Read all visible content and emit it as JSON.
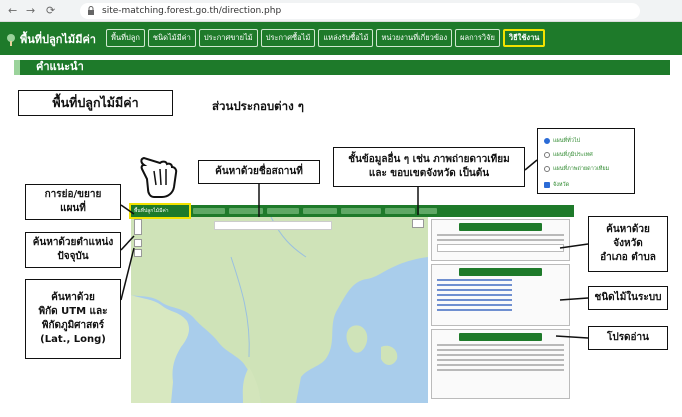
{
  "browser": {
    "back_icon": "arrow-left-icon",
    "forward_icon": "arrow-right-icon",
    "reload_icon": "reload-icon",
    "url": "site-matching.forest.go.th/direction.php"
  },
  "site": {
    "logo_text": "พื้นที่ปลูกไม้มีค่า",
    "menu": [
      "พื้นที่ปลูก",
      "ชนิดไม้มีค่า",
      "ประกาศขายไม้",
      "ประกาศซื้อไม้",
      "แหล่งรับซื้อไม้",
      "หน่วยงานที่เกี่ยวข้อง",
      "ผลการวิจัย",
      "วิธีใช้งาน"
    ],
    "active_menu": "วิธีใช้งาน",
    "accent_color": "#1e7a2a",
    "highlight_color": "#f2e200"
  },
  "page": {
    "section_title": "คำแนะนำ",
    "boxed_title": "พื้นที่ปลูกไม้มีค่า",
    "subtitle": "ส่วนประกอบต่าง ๆ"
  },
  "callouts": {
    "zoom": "การย่อ/ขยาย\nแผนที่",
    "location": "ค้นหาด้วยตำแหน่ง\nปัจจุบัน",
    "coords": "ค้นหาด้วย\nพิกัด UTM และ\nพิกัดภูมิศาสตร์\n(Lat., Long)",
    "place_search": "ค้นหาด้วยชื่อสถานที่",
    "other_data": "ชั้นข้อมูลอื่น ๆ เช่น ภาพถ่ายดาวเทียม\nและ ขอบเขตจังหวัด เป็นต้น",
    "province_search": "ค้นหาด้วย\nจังหวัด\nอำเภอ ตำบล",
    "tree_types": "ชนิดไม้ในระบบ",
    "please_read": "โปรดอ่าน"
  },
  "map_layers": {
    "options": [
      "แผนที่ทั่วไป",
      "แผนที่ภูมิประเทศ",
      "แผนที่ภาพถ่ายดาวเทียม"
    ],
    "selected": "แผนที่ทั่วไป",
    "checkbox_label": "จังหวัด",
    "checkbox_checked": true
  },
  "icons": {
    "hand_pointer": "hand-pointer-icon"
  }
}
